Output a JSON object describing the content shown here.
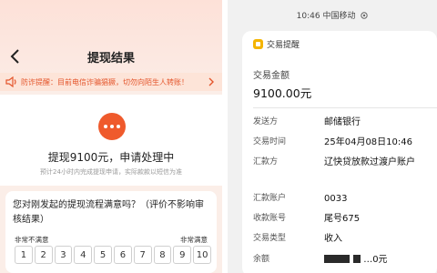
{
  "left": {
    "header": {
      "title": "提现结果"
    },
    "notice": {
      "text": "防诈提醒：目前电信诈骗猖獗，切勿向陌生人转账！"
    },
    "status": {
      "main": "提现9100元，申请处理中",
      "sub": "预计24小时内完成提现申请，实际款款以短信为准"
    },
    "survey": {
      "question": "您对刚发起的提现流程满意吗？（评价不影响审核结果）",
      "scale_low": "非常不满意",
      "scale_high": "非常满意",
      "options": [
        "1",
        "2",
        "3",
        "4",
        "5",
        "6",
        "7",
        "8",
        "9",
        "10"
      ]
    }
  },
  "right": {
    "statusbar": "10:46 中国移动",
    "card": {
      "app_name": "交易提醒",
      "amount_label": "交易金额",
      "amount_value": "9100.00元",
      "rows": [
        {
          "key": "发送方",
          "value": "邮储银行"
        },
        {
          "key": "交易时间",
          "value": "25年04月08日10:46"
        },
        {
          "key": "汇款方",
          "value": "辽快贷放款过渡户账户"
        },
        {
          "key": "汇款账户",
          "value": "0033"
        },
        {
          "key": "收款账号",
          "value": "尾号675"
        },
        {
          "key": "交易类型",
          "value": "收入"
        },
        {
          "key": "余额",
          "value": "…0元"
        }
      ]
    }
  },
  "colors": {
    "accent": "#ef5a2c",
    "notice_text": "#e4552b",
    "app_icon": "#f4b400"
  }
}
